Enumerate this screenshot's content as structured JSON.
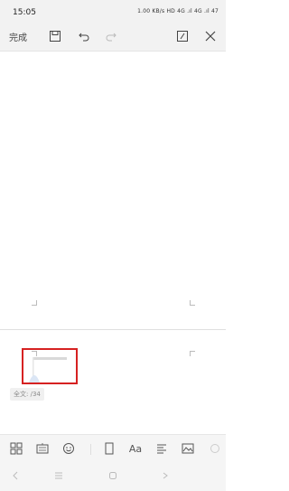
{
  "status_bar": {
    "time": "15:05",
    "icons_text": "1.00 KB/s  HD 4G .ıl  4G .ıl  47"
  },
  "toolbar": {
    "done_label": "完成",
    "icons": [
      "save-icon",
      "undo-icon",
      "redo-icon",
      "edit-icon",
      "close-icon"
    ]
  },
  "editor": {
    "word_count": "全文: /34"
  },
  "bottom_toolbar": {
    "items": [
      "grid-icon",
      "keyboard-icon",
      "emoji-icon",
      "frame-icon",
      "font-icon",
      "align-icon",
      "image-icon",
      "more-icon"
    ],
    "font_label": "Aa"
  },
  "nav_bar": {
    "items": [
      "nav-back-icon",
      "nav-menu-icon",
      "nav-home-icon",
      "nav-recent-icon"
    ]
  },
  "colors": {
    "highlight_border": "#d62121",
    "toolbar_bg": "#f2f2f2"
  }
}
